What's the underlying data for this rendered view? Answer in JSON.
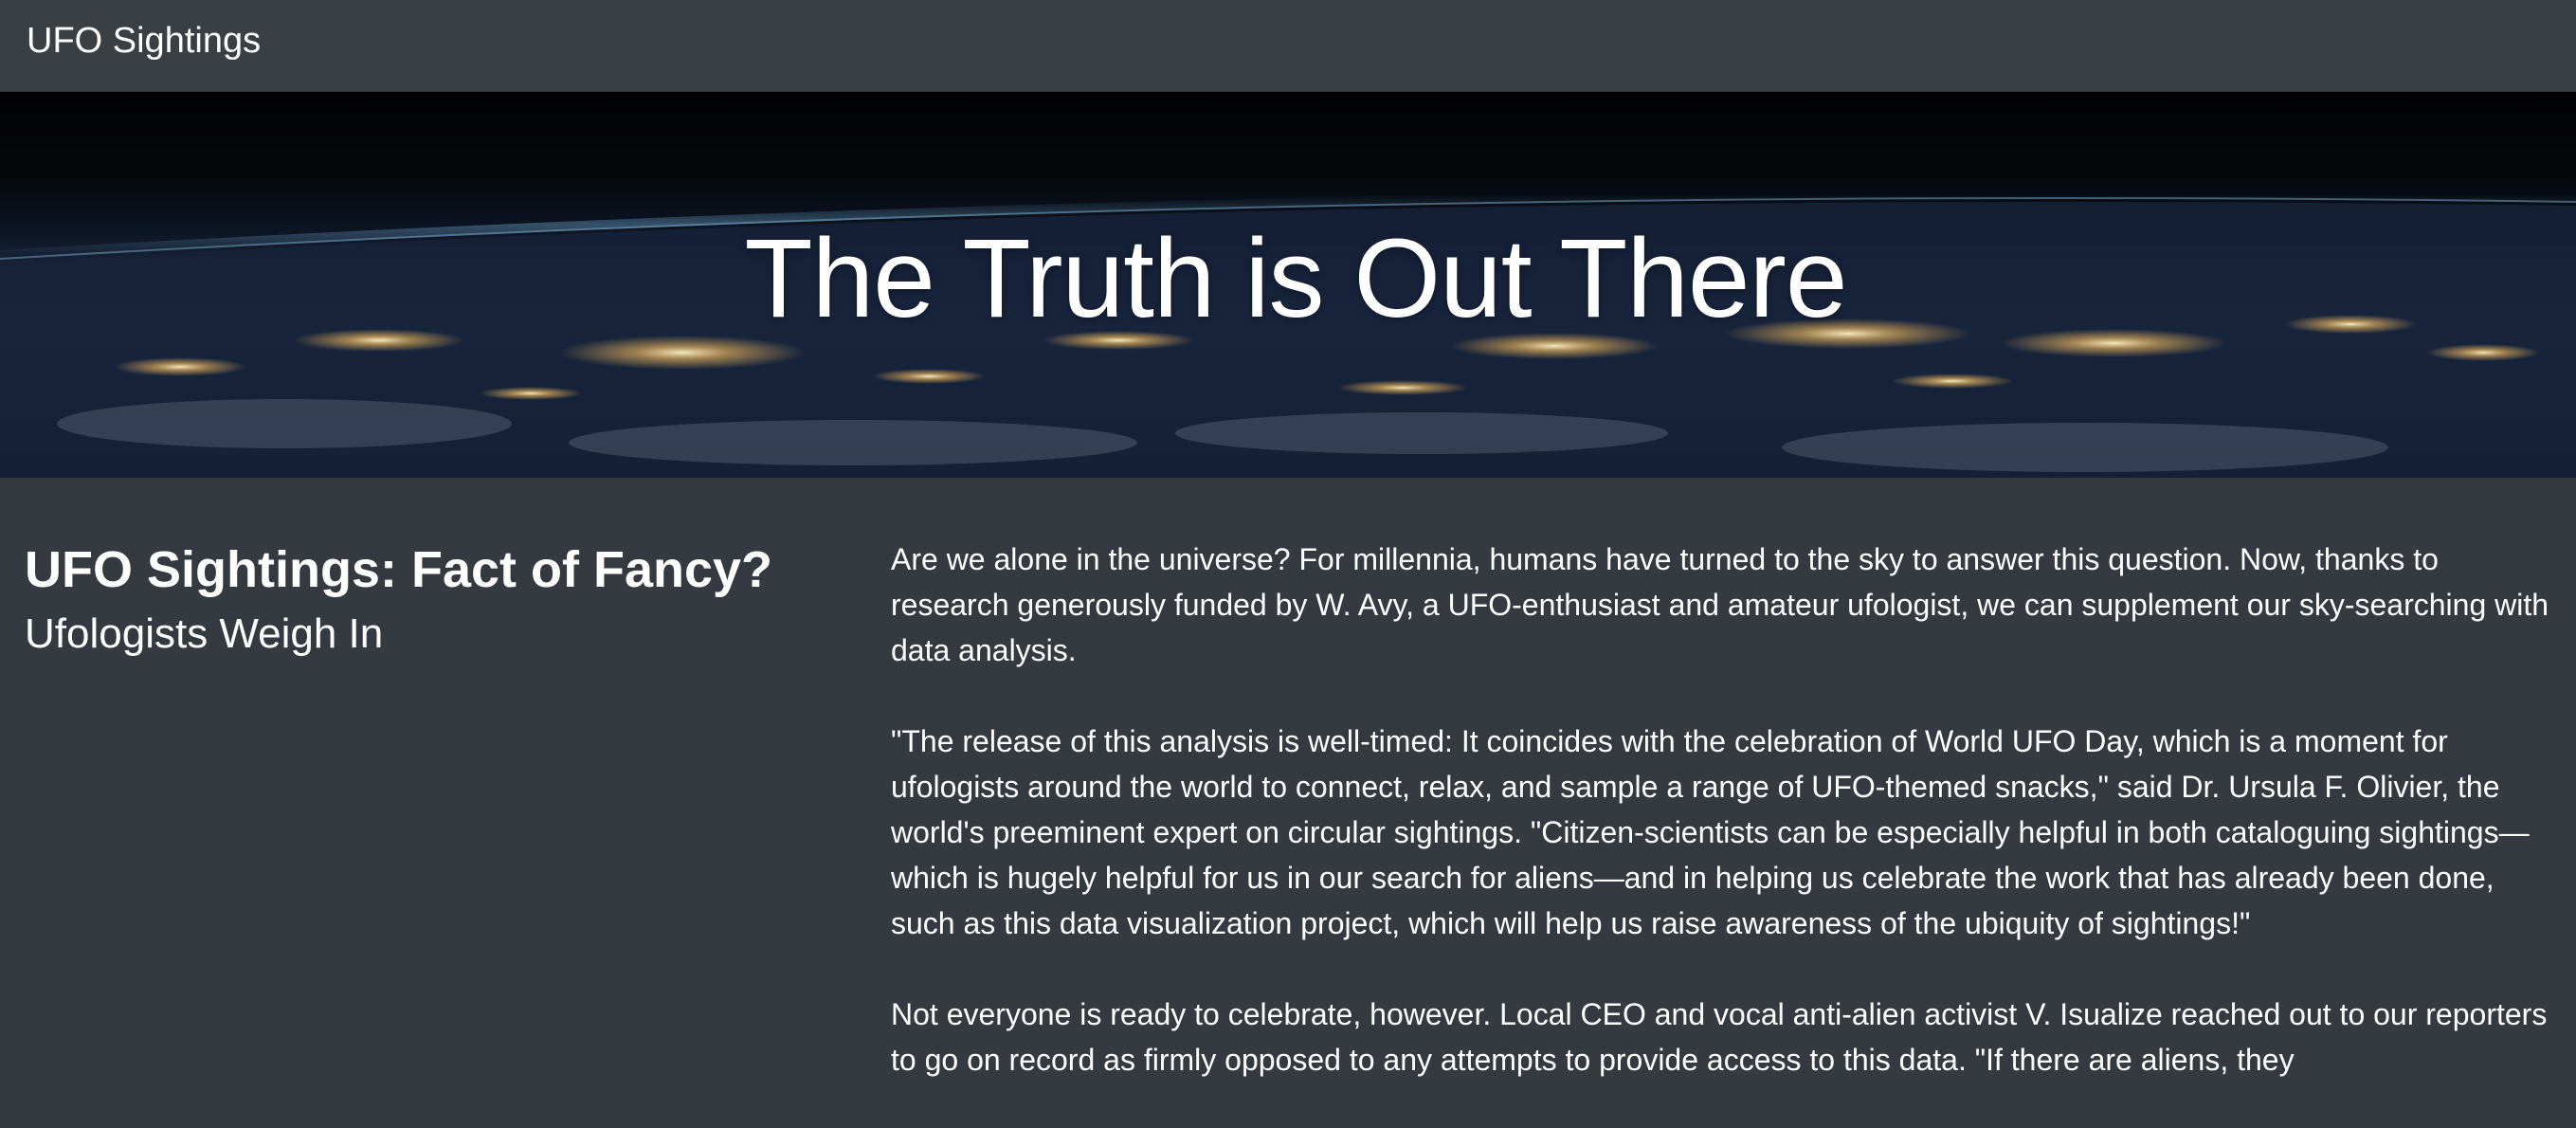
{
  "navbar": {
    "brand": "UFO Sightings"
  },
  "hero": {
    "title": "The Truth is Out There"
  },
  "article": {
    "headline": "UFO Sightings: Fact of Fancy?",
    "subheadline": "Ufologists Weigh In",
    "paragraphs": [
      "Are we alone in the universe? For millennia, humans have turned to the sky to answer this question. Now, thanks to research generously funded by W. Avy, a UFO-enthusiast and amateur ufologist, we can supplement our sky-searching with data analysis.",
      "\"The release of this analysis is well-timed: It coincides with the celebration of World UFO Day, which is a moment for ufologists around the world to connect, relax, and sample a range of UFO-themed snacks,\" said Dr. Ursula F. Olivier, the world's preeminent expert on circular sightings. \"Citizen-scientists can be especially helpful in both cataloguing sightings—which is hugely helpful for us in our search for aliens—and in helping us celebrate the work that has already been done, such as this data visualization project, which will help us raise awareness of the ubiquity of sightings!\"",
      "Not everyone is ready to celebrate, however. Local CEO and vocal anti-alien activist V. Isualize reached out to our reporters to go on record as firmly opposed to any attempts to provide access to this data. \"If there are aliens, they"
    ]
  },
  "colors": {
    "page_background": "#343a40",
    "navbar_background": "#3a3f44",
    "text": "#ffffff"
  }
}
